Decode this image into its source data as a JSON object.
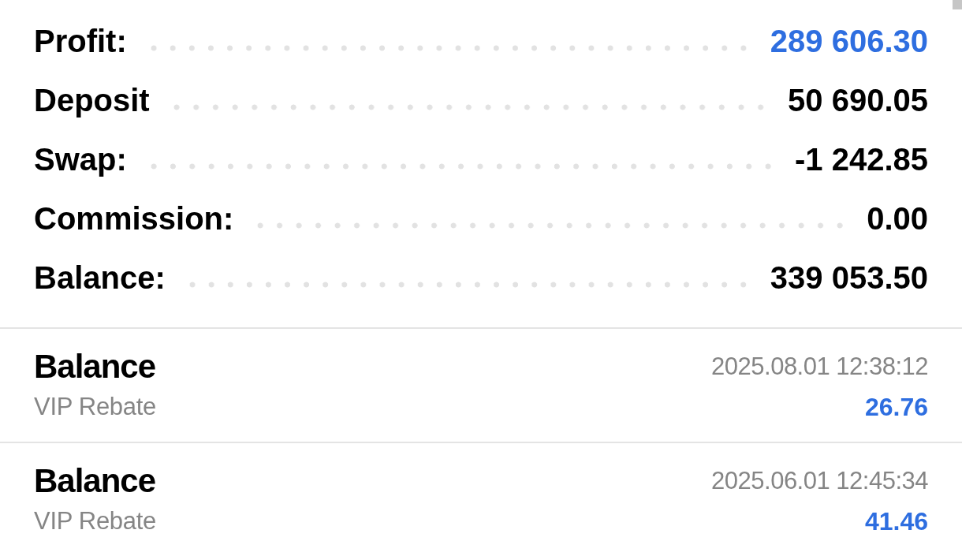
{
  "summary": [
    {
      "label": "Profit:",
      "value": "289 606.30",
      "color": "#2e6ee0"
    },
    {
      "label": "Deposit",
      "value": "50 690.05",
      "color": "#000000"
    },
    {
      "label": "Swap:",
      "value": "-1 242.85",
      "color": "#000000"
    },
    {
      "label": "Commission:",
      "value": "0.00",
      "color": "#000000"
    },
    {
      "label": "Balance:",
      "value": "339 053.50",
      "color": "#000000"
    }
  ],
  "transactions": [
    {
      "type": "Balance",
      "date": "2025.08.01 12:38:12",
      "comment": "VIP Rebate",
      "amount": "26.76"
    },
    {
      "type": "Balance",
      "date": "2025.06.01 12:45:34",
      "comment": "VIP Rebate",
      "amount": "41.46"
    }
  ]
}
